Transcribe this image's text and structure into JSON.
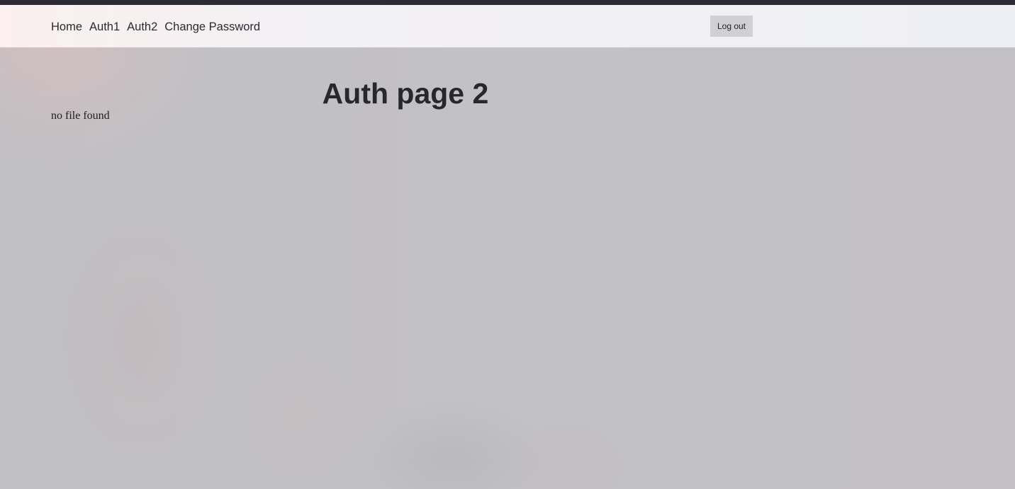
{
  "nav": {
    "items": [
      {
        "label": "Home"
      },
      {
        "label": "Auth1"
      },
      {
        "label": "Auth2"
      },
      {
        "label": "Change Password"
      }
    ],
    "logout_label": "Log out"
  },
  "main": {
    "title": "Auth page 2",
    "status": "no file found"
  }
}
